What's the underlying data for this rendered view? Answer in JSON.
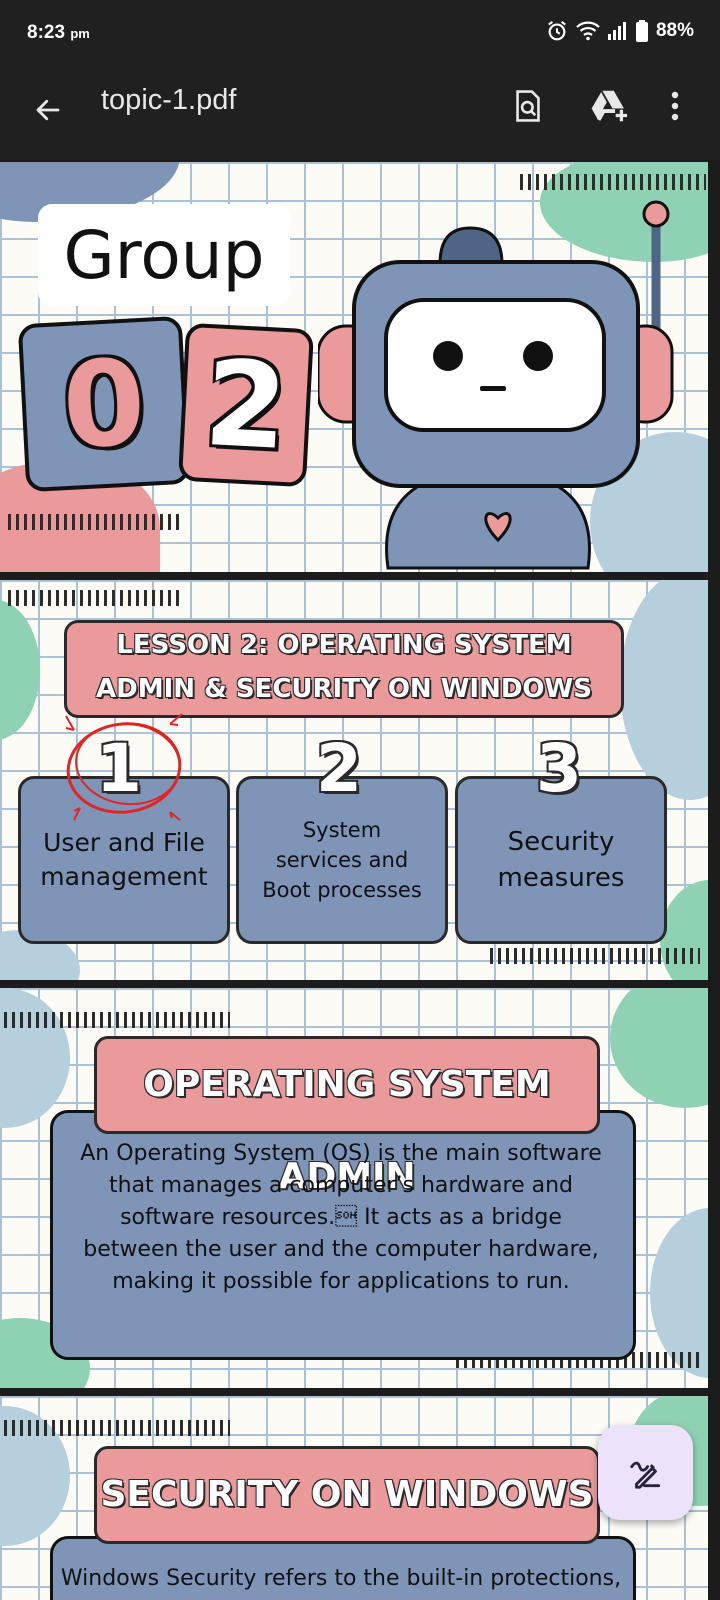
{
  "status_bar": {
    "time": "8:23",
    "time_suffix": "pm",
    "battery": "88%"
  },
  "app_bar": {
    "title": "topic-1.pdf"
  },
  "slides": {
    "cover": {
      "group_label": "Group",
      "digit_1": "0",
      "digit_2": "2"
    },
    "lesson": {
      "title_line1": "LESSON 2: OPERATING SYSTEM",
      "title_line2": "ADMIN & SECURITY ON WINDOWS",
      "topics": [
        {
          "number": "1",
          "label": "User and File management"
        },
        {
          "number": "2",
          "label": "System services and Boot processes"
        },
        {
          "number": "3",
          "label": "Security measures"
        }
      ]
    },
    "os_admin": {
      "heading": "OPERATING SYSTEM ADMIN",
      "body": "An Operating System (OS) is the main software that manages a computer’s hardware and software resources.\u0001 It acts as a bridge between the user and the computer hardware, making it possible for applications to run."
    },
    "security": {
      "heading": "SECURITY ON WINDOWS",
      "body_partial": "Windows Security refers to the built-in protections,"
    }
  },
  "icons": {
    "back": "arrow-left-icon",
    "search": "search-document-icon",
    "drive": "drive-add-icon",
    "menu": "more-vert-icon",
    "fab": "annotate-pen-icon"
  },
  "colors": {
    "pink": "#eb9a9c",
    "blue": "#7f95b8",
    "mint": "#8fd1b3",
    "fab_bg": "#ece3fb"
  }
}
